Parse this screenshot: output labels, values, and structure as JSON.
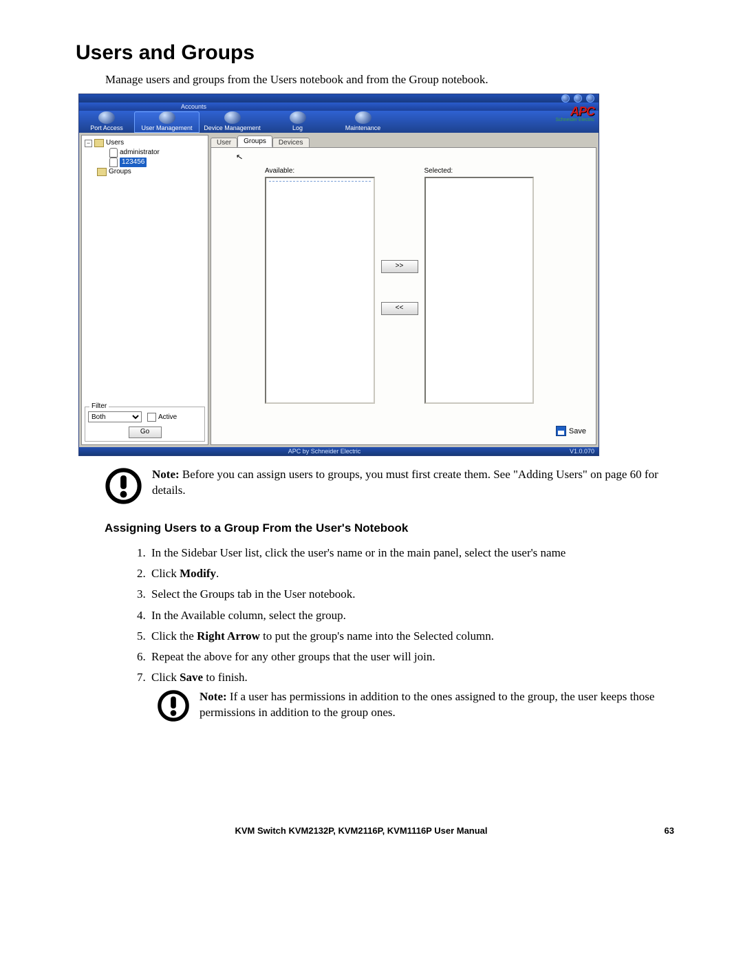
{
  "doc": {
    "title": "Users and Groups",
    "lead": "Manage users and groups from the Users notebook and from the Group notebook.",
    "subheading": "Assigning Users to a Group From the User's Notebook",
    "note1_label": "Note:",
    "note1_text": " Before you can assign users to groups, you must first create them. See \"Adding Users\" on page 60 for details.",
    "note2_label": "Note:",
    "note2_text": " If a user has permissions in addition to the ones assigned to the group, the user keeps those permissions in addition to the group ones.",
    "footer_title": "KVM Switch KVM2132P, KVM2116P, KVM1116P User Manual",
    "footer_page": "63"
  },
  "steps": [
    {
      "pre": "In the Sidebar User list, click the user's name or in the main panel, select the user's name"
    },
    {
      "pre": "Click ",
      "bold": "Modify",
      "post": "."
    },
    {
      "pre": "Select the Groups tab in the User notebook."
    },
    {
      "pre": "In the Available column, select the group."
    },
    {
      "pre": "Click the ",
      "bold": "Right Arrow",
      "post": " to put the group's name into the Selected column."
    },
    {
      "pre": "Repeat the above for any other groups that the user will join."
    },
    {
      "pre": "Click ",
      "bold": "Save",
      "post": " to finish."
    }
  ],
  "app": {
    "brand1": "APC",
    "brand2": "Schneider Electric",
    "menu_accounts": "Accounts",
    "nav": {
      "port": "Port Access",
      "user": "User Management",
      "device": "Device Management",
      "log": "Log",
      "maint": "Maintenance"
    },
    "tree": {
      "users": "Users",
      "admin": "administrator",
      "sel": "123456",
      "groups": "Groups"
    },
    "filter": {
      "legend": "Filter",
      "both": "Both",
      "active": "Active",
      "go": "Go"
    },
    "tabs": {
      "user": "User",
      "groups": "Groups",
      "devices": "Devices"
    },
    "lists": {
      "available": "Available:",
      "selected": "Selected:"
    },
    "btn": {
      "right": ">>",
      "left": "<<",
      "save": "Save"
    },
    "status": {
      "mid": "APC by Schneider Electric",
      "ver": "V1.0.070"
    }
  }
}
